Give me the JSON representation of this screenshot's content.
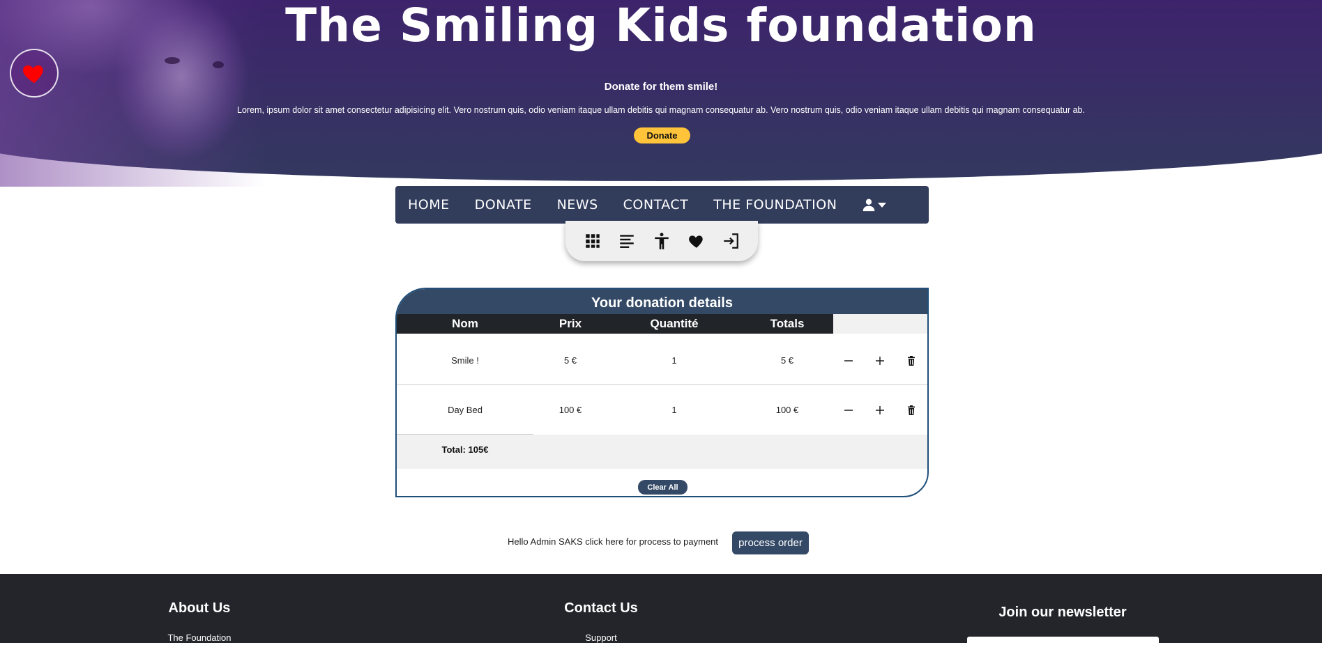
{
  "hero": {
    "title": "The Smiling Kids foundation",
    "tagline": "Donate for them smile!",
    "lorem": "Lorem, ipsum dolor sit amet consectetur adipisicing elit. Vero nostrum quis, odio veniam itaque ullam debitis qui magnam consequatur ab. Vero nostrum quis, odio veniam itaque ullam debitis qui magnam consequatur ab.",
    "donate_label": "Donate"
  },
  "nav": {
    "items": [
      "HOME",
      "DONATE",
      "NEWS",
      "CONTACT",
      "THE FOUNDATION"
    ]
  },
  "toolbar": {
    "icons": [
      "grid-icon",
      "align-left-icon",
      "accessibility-icon",
      "heart-icon",
      "logout-icon"
    ]
  },
  "donation": {
    "title": "Your donation details",
    "columns": [
      "Nom",
      "Prix",
      "Quantité",
      "Totals"
    ],
    "rows": [
      {
        "name": "Smile !",
        "price": "5 €",
        "qty": "1",
        "total": "5 €"
      },
      {
        "name": "Day Bed",
        "price": "100 €",
        "qty": "1",
        "total": "100 €"
      }
    ],
    "total": "Total: 105€",
    "clear_label": "Clear All"
  },
  "payment": {
    "text": "Hello Admin SAKS click here for process to payment",
    "process_label": "process order"
  },
  "footer": {
    "about_title": "About Us",
    "about_link": "The Foundation",
    "contact_title": "Contact Us",
    "contact_link": "Support",
    "newsletter_title": "Join our newsletter"
  },
  "colors": {
    "hero_top": "#4a0f78",
    "hero_bottom": "#33395f",
    "nav_bg": "#323d5c",
    "accent": "#334966",
    "paypal": "#ffc439",
    "footer_bg": "#23252b"
  }
}
